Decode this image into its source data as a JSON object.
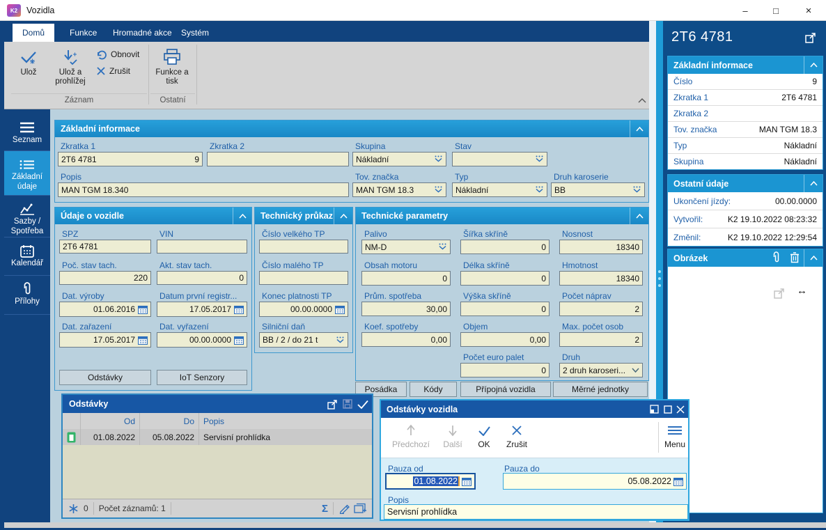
{
  "colors": {
    "accent_cyan": "#1B95D2",
    "navy": "#11437E",
    "right_panel_navy": "#0E4C88",
    "popup_title_blue": "#1757A5",
    "field_cream": "#EDEDD3",
    "dialog_bg": "#D8EEF8",
    "dialog_field_yellow": "#FEFEE6",
    "label_blue": "#1F5FA8",
    "content_bg": "#BAD1DE",
    "ribbon_gray": "#D5D5D5"
  },
  "window": {
    "logo_text": "K2",
    "title": "Vozidla"
  },
  "tabs": [
    {
      "label": "Domů"
    },
    {
      "label": "Funkce"
    },
    {
      "label": "Hromadné akce"
    },
    {
      "label": "Systém"
    }
  ],
  "ribbon": {
    "save": "Ulož",
    "save_view_1": "Ulož a",
    "save_view_2": "prohlížej",
    "refresh": "Obnovit",
    "cancel": "Zrušit",
    "print_1": "Funkce a",
    "print_2": "tisk",
    "group_record": "Záznam",
    "group_other": "Ostatní"
  },
  "sidebar": {
    "items": [
      {
        "label": "Seznam"
      },
      {
        "line1": "Základní",
        "line2": "údaje"
      },
      {
        "line1": "Sazby /",
        "line2": "Spotřeba"
      },
      {
        "label": "Kalendář"
      },
      {
        "label": "Přílohy"
      }
    ]
  },
  "basic": {
    "title": "Základní informace",
    "zkratka1_label": "Zkratka 1",
    "zkratka1_value": "2T6 4781",
    "zkratka1_num": "9",
    "zkratka2_label": "Zkratka 2",
    "zkratka2_value": "",
    "skupina_label": "Skupina",
    "skupina_value": "Nákladní",
    "stav_label": "Stav",
    "stav_value": "",
    "popis_label": "Popis",
    "popis_value": "MAN TGM 18.340",
    "tov_label": "Tov. značka",
    "tov_value": "MAN TGM 18.3",
    "typ_label": "Typ",
    "typ_value": "Nákladní",
    "druh_label": "Druh karoserie",
    "druh_value": "BB"
  },
  "vehicle": {
    "title": "Údaje o vozidle",
    "spz_label": "SPZ",
    "spz_value": "2T6 4781",
    "vin_label": "VIN",
    "vin_value": "",
    "poc_label": "Poč. stav tach.",
    "poc_value": "220",
    "akt_label": "Akt. stav tach.",
    "akt_value": "0",
    "vyroby_label": "Dat. výroby",
    "vyroby_value": "01.06.2016",
    "reg_label": "Datum první registr...",
    "reg_value": "17.05.2017",
    "zarazeni_label": "Dat. zařazení",
    "zarazeni_value": "17.05.2017",
    "vyrazeni_label": "Dat. vyřazení",
    "vyrazeni_value": "00.00.0000",
    "btn_odstavky": "Odstávky",
    "btn_iot": "IoT Senzory"
  },
  "techcard": {
    "title": "Technický průkaz",
    "big_label": "Číslo velkého TP",
    "big_value": "",
    "small_label": "Číslo malého TP",
    "small_value": "",
    "valid_label": "Konec platnosti TP",
    "valid_value": "00.00.0000",
    "tax_label": "Silniční daň",
    "tax_value": "BB / 2 / do 21 t"
  },
  "techparams": {
    "title": "Technické parametry",
    "palivo_label": "Palivo",
    "palivo_value": "NM-D",
    "sirka_label": "Šířka skříně",
    "sirka_value": "0",
    "nosnost_label": "Nosnost",
    "nosnost_value": "18340",
    "obsah_label": "Obsah motoru",
    "obsah_value": "0",
    "delka_label": "Délka skříně",
    "delka_value": "0",
    "hmotnost_label": "Hmotnost",
    "hmotnost_value": "18340",
    "prum_label": "Prům. spotřeba",
    "prum_value": "30,00",
    "vyska_label": "Výška skříně",
    "vyska_value": "0",
    "napravy_label": "Počet náprav",
    "napravy_value": "2",
    "koef_label": "Koef. spotřeby",
    "koef_value": "0,00",
    "objem_label": "Objem",
    "objem_value": "0,00",
    "osob_label": "Max. počet osob",
    "osob_value": "2",
    "palet_label": "Počet euro palet",
    "palet_value": "0",
    "druh_label": "Druh",
    "druh_value": "2  druh karoseri..."
  },
  "bottom_buttons": {
    "posadka": "Posádka",
    "kody": "Kódy",
    "pripojna": "Přípojná vozidla",
    "merne": "Měrné jednotky"
  },
  "odstavky": {
    "title": "Odstávky",
    "col_od": "Od",
    "col_do": "Do",
    "col_popis": "Popis",
    "row": {
      "od": "01.08.2022",
      "do": "05.08.2022",
      "popis": "Servisní prohlídka"
    },
    "changes": "0",
    "count": "Počet záznamů: 1",
    "sigma": "Σ"
  },
  "dialog": {
    "title": "Odstávky vozidla",
    "prev": "Předchozí",
    "next": "Další",
    "ok": "OK",
    "cancel": "Zrušit",
    "menu": "Menu",
    "pauza_od_label": "Pauza od",
    "pauza_od_value": "01.08.2022",
    "pauza_do_label": "Pauza do",
    "pauza_do_value": "05.08.2022",
    "popis_label": "Popis",
    "popis_value": "Servisní prohlídka"
  },
  "right_panel": {
    "header": "2T6 4781",
    "sec1_title": "Základní informace",
    "sec1_rows": [
      {
        "label": "Číslo",
        "value": "9"
      },
      {
        "label": "Zkratka 1",
        "value": "2T6 4781"
      },
      {
        "label": "Zkratka 2",
        "value": ""
      },
      {
        "label": "Tov. značka",
        "value": "MAN TGM 18.3"
      },
      {
        "label": "Typ",
        "value": "Nákladní"
      },
      {
        "label": "Skupina",
        "value": "Nákladní"
      }
    ],
    "sec2_title": "Ostatní údaje",
    "sec2_rows": [
      {
        "label": "Ukončení jízdy:",
        "value": "00.00.0000"
      },
      {
        "label": "Vytvořil:",
        "value": "K2 19.10.2022 08:23:32"
      },
      {
        "label": "Změnil:",
        "value": "K2 19.10.2022 12:29:54"
      }
    ],
    "sec3_title": "Obrázek",
    "resize_glyph": "↔"
  },
  "chrome": {
    "minimize": "–",
    "maximize": "□",
    "close": "×"
  }
}
